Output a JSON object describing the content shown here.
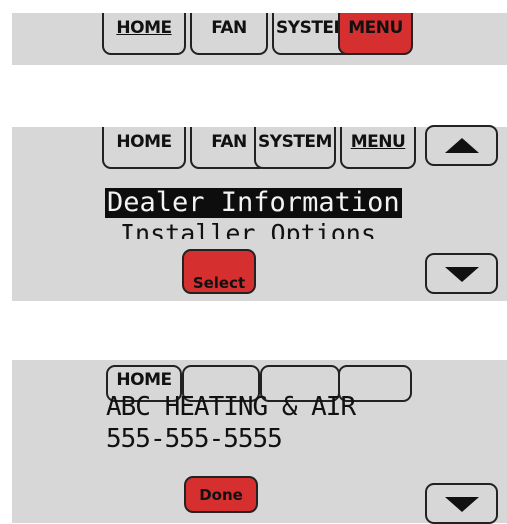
{
  "panel1": {
    "tabs": [
      {
        "label": "HOME",
        "underlined": true
      },
      {
        "label": "FAN"
      },
      {
        "label": "SYSTEM"
      },
      {
        "label": "MENU",
        "active": true
      }
    ]
  },
  "panel2": {
    "tabs": [
      {
        "label": "HOME"
      },
      {
        "label": "FAN"
      },
      {
        "label": "SYSTEM"
      },
      {
        "label": "MENU",
        "underlined": true
      }
    ],
    "menu_items": [
      "Dealer Information",
      "Installer Options"
    ],
    "selected_item": "Dealer Information",
    "select_button": "Select",
    "up_arrow_icon": "triangle-up",
    "down_arrow_icon": "triangle-down"
  },
  "panel3": {
    "tabs": [
      {
        "label": "HOME"
      },
      {
        "label": ""
      },
      {
        "label": ""
      },
      {
        "label": ""
      }
    ],
    "dealer_name": "ABC HEATING & AIR",
    "dealer_phone": "555-555-5555",
    "done_button": "Done",
    "down_arrow_icon": "triangle-down"
  },
  "colors": {
    "panel_bg": "#d7d7d7",
    "active_red": "#d62f2f",
    "highlight_bg": "#0d0d0d"
  }
}
